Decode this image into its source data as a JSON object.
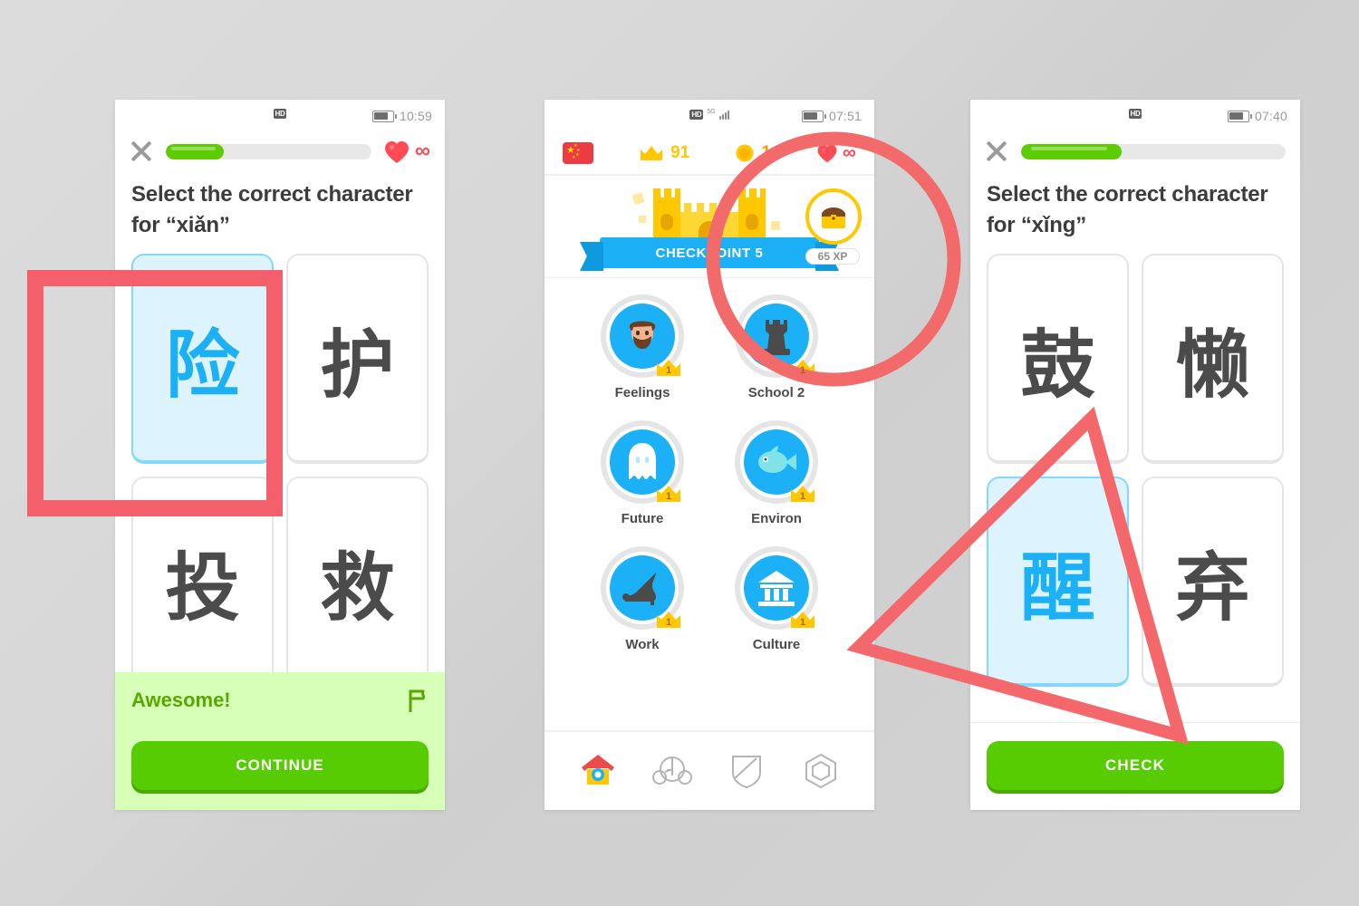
{
  "annotations": {
    "rect_color": "#f3606c",
    "circle_color": "#f26a69",
    "triangle_color": "#f4676b",
    "shapes": [
      "rectangle-highlight",
      "circle-highlight",
      "triangle-pointer"
    ]
  },
  "phone1": {
    "status": {
      "hd": "HD",
      "time": "10:59"
    },
    "header": {
      "close_icon": "close-x-icon",
      "progress_percent": 28,
      "hearts_icon": "heart-icon",
      "infinity": "∞"
    },
    "prompt": "Select the correct character for “xiǎn”",
    "tiles": [
      {
        "char": "险",
        "selected": true
      },
      {
        "char": "护",
        "selected": false
      },
      {
        "char": "投",
        "selected": false
      },
      {
        "char": "救",
        "selected": false
      }
    ],
    "feedback": {
      "title": "Awesome!",
      "flag_icon": "report-flag-icon",
      "button": "CONTINUE"
    }
  },
  "phone2": {
    "status": {
      "hd": "HD",
      "signal_label": "5G",
      "time": "07:51"
    },
    "topbar": {
      "flag_icon": "china-flag-icon",
      "crown_icon": "crown-icon",
      "crown_count": "91",
      "gem_icon": "gem-icon",
      "gem_count": "1",
      "heart_icon": "heart-icon",
      "infinity": "∞"
    },
    "checkpoint": {
      "banner": "CHECKPOINT 5",
      "castle_icon": "castle-icon",
      "chest_icon": "treasure-chest-icon",
      "xp": "65 XP"
    },
    "skills": [
      {
        "name": "Feelings",
        "icon": "bearded-face-icon",
        "crown": "1"
      },
      {
        "name": "School 2",
        "icon": "chess-rook-icon",
        "crown": "1"
      },
      {
        "name": "Future",
        "icon": "ghost-icon",
        "crown": "1"
      },
      {
        "name": "Environ",
        "icon": "fish-icon",
        "crown": "1"
      },
      {
        "name": "Work",
        "icon": "high-heel-shoe-icon",
        "crown": "1"
      },
      {
        "name": "Culture",
        "icon": "bank-building-icon",
        "crown": "1"
      }
    ],
    "nav": [
      {
        "icon": "home-icon",
        "active": true
      },
      {
        "icon": "owl-mascot-icon",
        "active": false
      },
      {
        "icon": "shield-icon",
        "active": false
      },
      {
        "icon": "gem-outline-icon",
        "active": false
      }
    ]
  },
  "phone3": {
    "status": {
      "hd": "HD",
      "time": "07:40"
    },
    "header": {
      "close_icon": "close-x-icon",
      "progress_percent": 38
    },
    "prompt": "Select the correct character for “xǐng”",
    "tiles": [
      {
        "char": "鼓",
        "selected": false
      },
      {
        "char": "懒",
        "selected": false
      },
      {
        "char": "醒",
        "selected": true
      },
      {
        "char": "弃",
        "selected": false
      }
    ],
    "footer": {
      "button": "CHECK"
    }
  },
  "colors": {
    "green": "#58cc02",
    "green_progress": "#5bcd02",
    "green_dark": "#4aa802",
    "feedback_bg": "#d7ffb8",
    "feedback_text": "#58a700",
    "blue": "#1cb0f6",
    "tile_selected_bg": "#ddf4fe",
    "tile_selected_border": "#84d8ff",
    "gold": "#ffc800",
    "red": "#ff4b55",
    "text": "#4b4b4b"
  }
}
